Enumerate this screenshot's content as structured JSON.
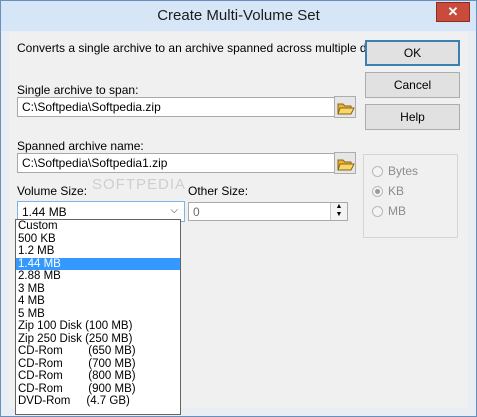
{
  "window": {
    "title": "Create Multi-Volume Set",
    "close_glyph": "✕"
  },
  "description": "Converts a single archive to an archive spanned across multiple disks.",
  "source": {
    "label": "Single archive to span:",
    "value": "C:\\Softpedia\\Softpedia.zip"
  },
  "target": {
    "label": "Spanned archive name:",
    "value": "C:\\Softpedia\\Softpedia1.zip"
  },
  "buttons": {
    "ok": "OK",
    "cancel": "Cancel",
    "help": "Help"
  },
  "volume": {
    "label": "Volume Size:",
    "selected": "1.44 MB",
    "watermark": "SOFTPEDIA"
  },
  "other": {
    "label": "Other Size:",
    "value": "0"
  },
  "units": {
    "bytes": "Bytes",
    "kb": "KB",
    "mb": "MB",
    "selected": "KB"
  },
  "volume_options": [
    "Custom",
    "500 KB",
    "1.2 MB",
    "1.44 MB",
    "2.88 MB",
    "3 MB",
    "4 MB",
    "5 MB",
    "Zip 100 Disk (100 MB)",
    "Zip 250 Disk (250 MB)",
    "CD-Rom        (650 MB)",
    "CD-Rom        (700 MB)",
    "CD-Rom        (800 MB)",
    "CD-Rom        (900 MB)",
    "DVD-Rom     (4.7 GB)"
  ],
  "selected_option_index": 3,
  "icons": {
    "folder": "folder-open-icon",
    "combo_arrow": "chevron-down-icon"
  }
}
